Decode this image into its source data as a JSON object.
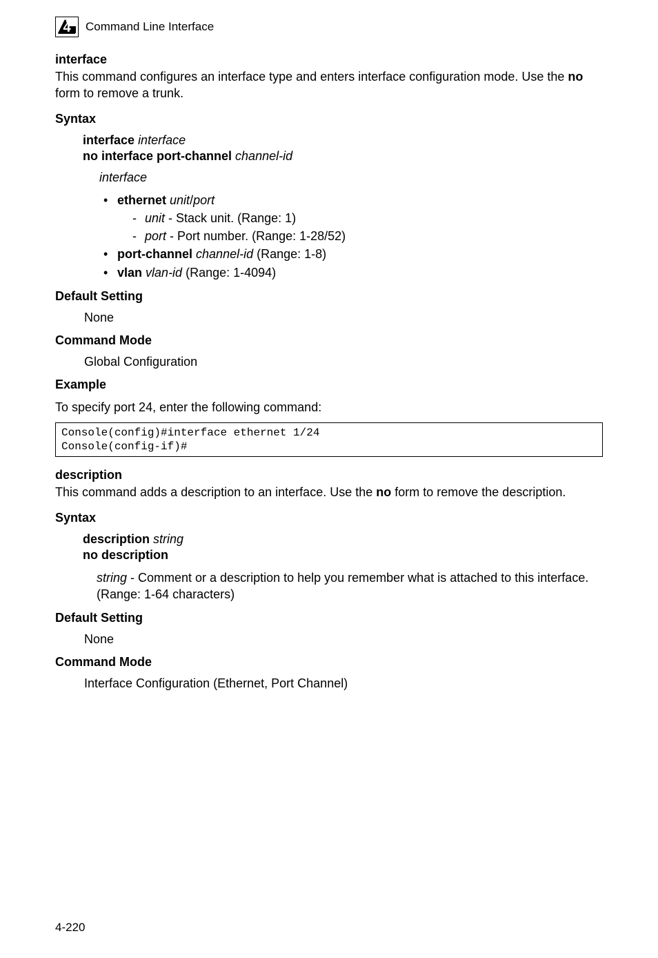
{
  "chapter_number": "4",
  "header_text": "Command Line Interface",
  "cmd1": {
    "name": "interface",
    "description_1": "This command configures an interface type and enters interface configuration mode. Use the ",
    "description_bold": "no",
    "description_2": " form to remove a trunk.",
    "syntax_title": "Syntax",
    "syntax_line1_bold": "interface",
    "syntax_line1_ital": "interface",
    "syntax_line2_bold": "no interface port-channel",
    "syntax_line2_ital": "channel-id",
    "interface_label": "interface",
    "eth_bold": "ethernet",
    "eth_unit": "unit",
    "eth_slash": "/",
    "eth_port": "port",
    "unit_label": "unit",
    "unit_desc": " - Stack unit. (Range: 1)",
    "port_label": "port",
    "port_desc": " - Port number. (Range: 1-28/52)",
    "pc_bold": "port-channel",
    "pc_ital": "channel-id",
    "pc_range": " (Range: 1-8)",
    "vlan_bold": "vlan",
    "vlan_ital": "vlan-id",
    "vlan_range": " (Range: 1-4094)",
    "default_title": "Default Setting",
    "default_val": "None",
    "mode_title": "Command Mode",
    "mode_val": "Global Configuration",
    "example_title": "Example",
    "example_desc": "To specify port 24, enter the following command:",
    "console_line1": "Console(config)#interface ethernet 1/24",
    "console_line2": "Console(config-if)#"
  },
  "cmd2": {
    "name": "description",
    "description_1": "This command adds a description to an interface. Use the ",
    "description_bold": "no",
    "description_2": " form to remove the description.",
    "syntax_title": "Syntax",
    "syntax_line1_bold": "description",
    "syntax_line1_ital": "string",
    "syntax_line2_bold": "no description",
    "string_label": "string",
    "string_desc": " - Comment or a description to help you remember what is attached to this interface. (Range: 1-64 characters)",
    "default_title": "Default Setting",
    "default_val": "None",
    "mode_title": "Command Mode",
    "mode_val": "Interface Configuration (Ethernet, Port Channel)"
  },
  "page_number": "4-220"
}
